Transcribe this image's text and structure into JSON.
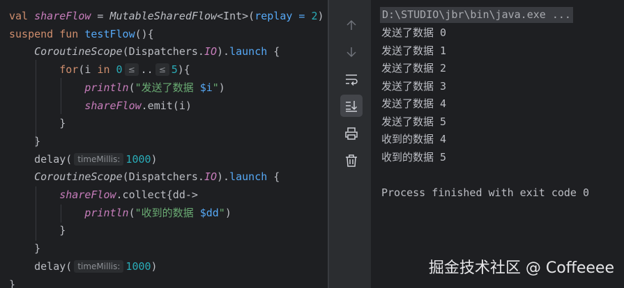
{
  "editor": {
    "lines": [
      {
        "tokens": [
          {
            "t": "val ",
            "c": "kw"
          },
          {
            "t": "shareFlow",
            "c": "it"
          },
          {
            "t": " = "
          },
          {
            "t": "MutableSharedFlow",
            "c": "cls"
          },
          {
            "t": "<Int>("
          },
          {
            "t": "replay = ",
            "c": "fn"
          },
          {
            "t": "2",
            "c": "num"
          },
          {
            "t": ")"
          }
        ]
      },
      {
        "tokens": [
          {
            "t": "suspend fun ",
            "c": "kw"
          },
          {
            "t": "testFlow",
            "c": "fn"
          },
          {
            "t": "(){"
          }
        ]
      },
      {
        "tokens": [
          {
            "t": "    "
          },
          {
            "t": "CoroutineScope",
            "c": "cls"
          },
          {
            "t": "(Dispatchers."
          },
          {
            "t": "IO",
            "c": "it"
          },
          {
            "t": ")."
          },
          {
            "t": "launch",
            "c": "fn"
          },
          {
            "t": " {"
          }
        ]
      },
      {
        "tokens": [
          {
            "t": "        "
          },
          {
            "t": "for",
            "c": "kw"
          },
          {
            "t": "(i "
          },
          {
            "t": "in ",
            "c": "kw"
          },
          {
            "t": "0",
            "c": "num"
          },
          {
            "t": "≤",
            "c": "hint"
          },
          {
            "t": ".."
          },
          {
            "t": "≤",
            "c": "hint"
          },
          {
            "t": "5",
            "c": "num"
          },
          {
            "t": "){"
          }
        ]
      },
      {
        "tokens": [
          {
            "t": "            "
          },
          {
            "t": "println",
            "c": "it"
          },
          {
            "t": "("
          },
          {
            "t": "\"发送了数据 ",
            "c": "str"
          },
          {
            "t": "$i",
            "c": "fn"
          },
          {
            "t": "\"",
            "c": "str"
          },
          {
            "t": ")"
          }
        ]
      },
      {
        "tokens": [
          {
            "t": "            "
          },
          {
            "t": "shareFlow",
            "c": "it"
          },
          {
            "t": ".emit(i)"
          }
        ]
      },
      {
        "tokens": [
          {
            "t": "        }"
          }
        ]
      },
      {
        "tokens": [
          {
            "t": "    }"
          }
        ]
      },
      {
        "tokens": [
          {
            "t": "    delay("
          },
          {
            "t": "timeMillis:",
            "c": "hint"
          },
          {
            "t": "1000",
            "c": "num"
          },
          {
            "t": ")"
          }
        ]
      },
      {
        "tokens": [
          {
            "t": "    "
          },
          {
            "t": "CoroutineScope",
            "c": "cls"
          },
          {
            "t": "(Dispatchers."
          },
          {
            "t": "IO",
            "c": "it"
          },
          {
            "t": ")."
          },
          {
            "t": "launch",
            "c": "fn"
          },
          {
            "t": " {"
          }
        ]
      },
      {
        "tokens": [
          {
            "t": "        "
          },
          {
            "t": "shareFlow",
            "c": "it"
          },
          {
            "t": ".collect{dd->"
          }
        ]
      },
      {
        "tokens": [
          {
            "t": "            "
          },
          {
            "t": "println",
            "c": "it"
          },
          {
            "t": "("
          },
          {
            "t": "\"收到的数据 ",
            "c": "str"
          },
          {
            "t": "$dd",
            "c": "fn"
          },
          {
            "t": "\"",
            "c": "str"
          },
          {
            "t": ")"
          }
        ]
      },
      {
        "tokens": [
          {
            "t": "        }"
          }
        ]
      },
      {
        "tokens": [
          {
            "t": "    }"
          }
        ]
      },
      {
        "tokens": [
          {
            "t": "    delay("
          },
          {
            "t": "timeMillis:",
            "c": "hint"
          },
          {
            "t": "1000",
            "c": "num"
          },
          {
            "t": ")"
          }
        ]
      },
      {
        "tokens": [
          {
            "t": "}"
          }
        ]
      }
    ]
  },
  "toolbar": {
    "buttons": [
      {
        "icon": "arrow-up-icon",
        "active": false
      },
      {
        "icon": "arrow-down-icon",
        "active": false
      },
      {
        "icon": "soft-wrap-icon",
        "active": false
      },
      {
        "icon": "scroll-to-end-icon",
        "active": true
      },
      {
        "icon": "print-icon",
        "active": false
      },
      {
        "icon": "trash-icon",
        "active": false
      }
    ]
  },
  "console": {
    "command": "D:\\STUDIO\\jbr\\bin\\java.exe ...",
    "output": [
      "发送了数据 0",
      "发送了数据 1",
      "发送了数据 2",
      "发送了数据 3",
      "发送了数据 4",
      "发送了数据 5",
      "收到的数据 4",
      "收到的数据 5",
      "",
      "Process finished with exit code 0"
    ]
  },
  "watermark": "掘金技术社区 @ Coffeeee"
}
